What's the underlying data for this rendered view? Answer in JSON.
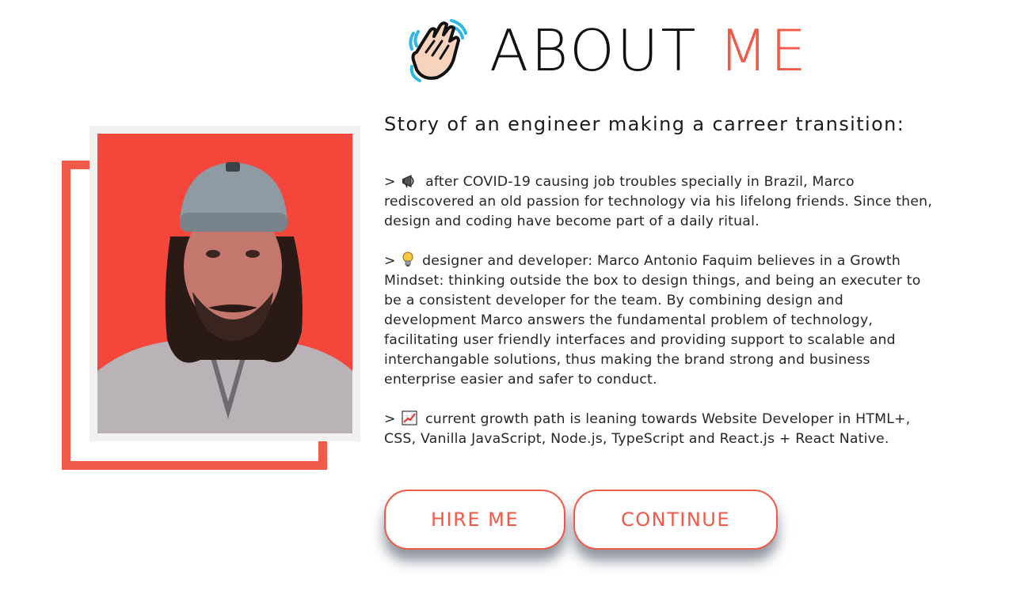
{
  "header": {
    "title_part1": "ABOUT",
    "title_part2": "ME",
    "icon": "waving-hand-icon",
    "accent_color": "#f05a48"
  },
  "profile": {
    "photo": "profile-photo",
    "frame_color": "#f05a48",
    "photo_background": "#f4463a"
  },
  "content": {
    "subtitle": "Story of an engineer making a carreer transition:",
    "paragraphs": [
      {
        "prefix": ">",
        "icon": "megaphone-icon",
        "text": "after COVID-19 causing job troubles specially in Brazil, Marco rediscovered an old passion for technology via his lifelong friends. Since then, design and coding have become part of a daily ritual."
      },
      {
        "prefix": ">",
        "icon": "light-bulb-icon",
        "text": "designer and developer: Marco Antonio Faquim believes in a Growth Mindset: thinking outside the box to design things, and being an executer to be a consistent developer for the team. By combining design and development Marco answers the fundamental problem of technology, facilitating user friendly interfaces and providing support to scalable and interchangable solutions, thus making the brand strong and business enterprise easier and safer to conduct."
      },
      {
        "prefix": ">",
        "icon": "chart-increasing-icon",
        "text": "current growth path is leaning towards Website Developer in HTML+, CSS, Vanilla JavaScript, Node.js, TypeScript and React.js + React Native."
      }
    ]
  },
  "actions": {
    "hire_label": "HIRE ME",
    "continue_label": "CONTINUE"
  }
}
